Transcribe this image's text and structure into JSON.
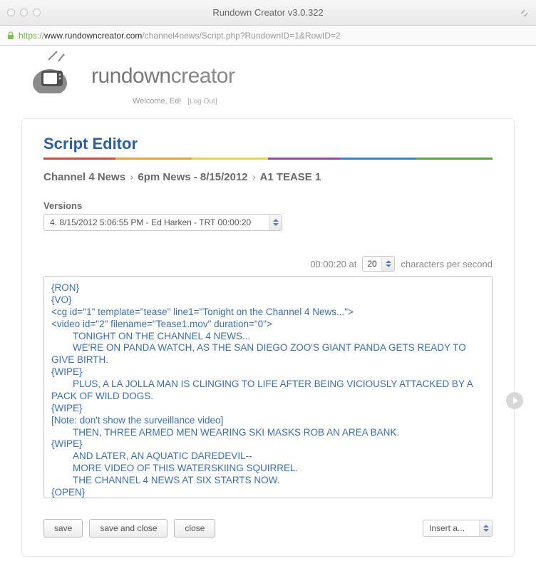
{
  "window": {
    "title": "Rundown Creator v3.0.322",
    "url_scheme": "https",
    "url_sep": "://",
    "url_domain": "www.rundowncreator.com",
    "url_path": "/channel4news/Script.php?RundownID=1&RowID=2"
  },
  "header": {
    "logo_text_1": "rundown",
    "logo_text_2": "creator",
    "welcome": "Welcome, Ed!",
    "logout": "[Log Out]"
  },
  "page": {
    "title": "Script Editor",
    "breadcrumb": {
      "a": "Channel 4 News",
      "b": "6pm News - 8/15/2012",
      "c": "A1 TEASE 1",
      "sep": "›"
    }
  },
  "versions": {
    "label": "Versions",
    "selected": "4. 8/15/2012 5:06:55 PM - Ed Harken - TRT 00:00:20"
  },
  "rate": {
    "trt": "00:00:20 at",
    "value": "20",
    "suffix": "characters per second"
  },
  "script_body": "{RON}\n{VO}\n<cg id=\"1\" template=\"tease\" line1=\"Tonight on the Channel 4 News...\">\n<video id=\"2\" filename=\"Tease1.mov\" duration=\"0\">\n        TONIGHT ON THE CHANNEL 4 NEWS...\n        WE'RE ON PANDA WATCH, AS THE SAN DIEGO ZOO'S GIANT PANDA GETS READY TO GIVE BIRTH.\n{WIPE}\n        PLUS, A LA JOLLA MAN IS CLINGING TO LIFE AFTER BEING VICIOUSLY ATTACKED BY A PACK OF WILD DOGS.\n{WIPE}\n[Note: don't show the surveillance video]\n        THEN, THREE ARMED MEN WEARING SKI MASKS ROB AN AREA BANK.\n{WIPE}\n        AND LATER, AN AQUATIC DAREDEVIL--\n        MORE VIDEO OF THIS WATERSKIING SQUIRREL.\n        THE CHANNEL 4 NEWS AT SIX STARTS NOW.\n{OPEN}",
  "buttons": {
    "save": "save",
    "save_close": "save and close",
    "close": "close",
    "insert": "Insert a..."
  }
}
